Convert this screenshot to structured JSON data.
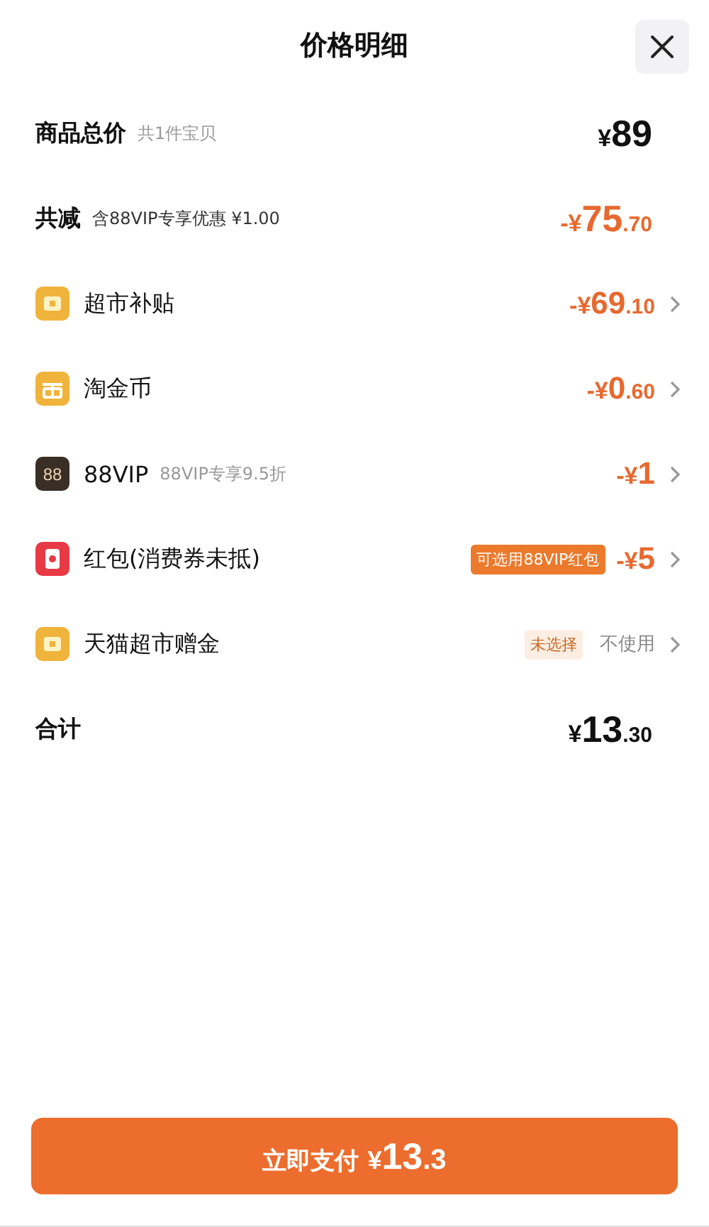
{
  "title": "价格明细",
  "rows": [
    {
      "kind": "summary",
      "label": "商品总价",
      "note": "共1件宝贝",
      "amount": {
        "prefix": "¥",
        "main": "89"
      },
      "negative": false
    },
    {
      "kind": "summary",
      "label": "共减",
      "note": "含88VIP专享优惠 ¥1.00",
      "amount": {
        "prefix": "-¥",
        "main": "75",
        "cents": ".70"
      },
      "negative": true
    },
    {
      "kind": "subsidy",
      "label": "超市补贴",
      "amount": {
        "prefix": "-¥",
        "main": "69",
        "cents": ".10"
      },
      "negative": true,
      "chevron": true
    },
    {
      "kind": "coins",
      "label": "淘金币",
      "amount": {
        "prefix": "-¥",
        "main": "0",
        "cents": ".60"
      },
      "negative": true,
      "chevron": true
    },
    {
      "kind": "vip",
      "icon_text": "88",
      "label": "88VIP",
      "note": "88VIP专享9.5折",
      "amount": {
        "prefix": "-¥",
        "main": "1"
      },
      "negative": true,
      "chevron": true
    },
    {
      "kind": "redpacket",
      "label": "红包(消费券未抵)",
      "badge": {
        "text": "可选用88VIP红包",
        "kind": "filled"
      },
      "amount": {
        "prefix": "-¥",
        "main": "5"
      },
      "negative": true,
      "chevron": true
    },
    {
      "kind": "subsidy",
      "label": "天猫超市赠金",
      "badge": {
        "text": "未选择",
        "kind": "soft"
      },
      "value_text": "不使用",
      "chevron": true
    },
    {
      "kind": "summary",
      "label": "合计",
      "amount": {
        "prefix": "¥",
        "main": "13",
        "cents": ".30"
      },
      "negative": false
    }
  ],
  "pay_button": {
    "label": "立即支付",
    "prefix": "¥",
    "main": "13",
    "cents": ".3"
  }
}
